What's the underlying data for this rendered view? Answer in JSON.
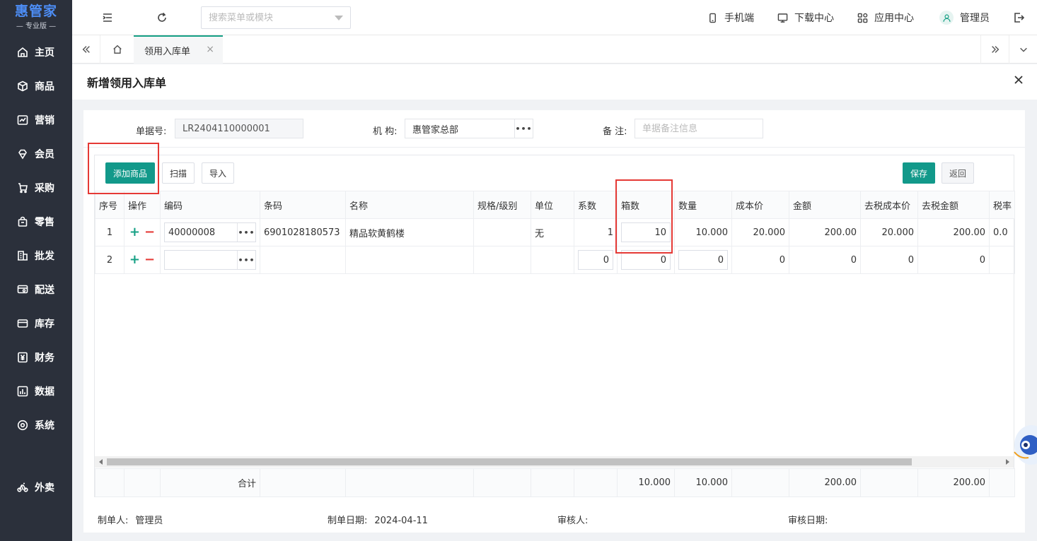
{
  "app": {
    "brand": "惠管家",
    "edition": "— 专业版 —"
  },
  "sidebar": {
    "items": [
      {
        "label": "主页",
        "icon": "home-icon"
      },
      {
        "label": "商品",
        "icon": "cube-icon"
      },
      {
        "label": "营销",
        "icon": "chart-icon"
      },
      {
        "label": "会员",
        "icon": "diamond-icon"
      },
      {
        "label": "采购",
        "icon": "cart-icon"
      },
      {
        "label": "零售",
        "icon": "bag-icon"
      },
      {
        "label": "批发",
        "icon": "building-icon"
      },
      {
        "label": "配送",
        "icon": "truck-icon"
      },
      {
        "label": "库存",
        "icon": "inventory-icon"
      },
      {
        "label": "财务",
        "icon": "yen-icon"
      },
      {
        "label": "数据",
        "icon": "bar-chart-icon"
      },
      {
        "label": "系统",
        "icon": "settings-icon"
      },
      {
        "label": "外卖",
        "icon": "bike-icon"
      }
    ]
  },
  "topbar": {
    "search_placeholder": "搜索菜单或模块",
    "mobile": "手机端",
    "download": "下载中心",
    "apps": "应用中心",
    "user": "管理员"
  },
  "tabs": {
    "active": "领用入库单"
  },
  "panel": {
    "title": "新增领用入库单"
  },
  "form": {
    "doc_no_label": "单据号:",
    "doc_no": "LR2404110000001",
    "org_label": "机 构:",
    "org": "惠管家总部",
    "remark_label": "备 注:",
    "remark_placeholder": "单据备注信息"
  },
  "toolbar": {
    "add": "添加商品",
    "scan": "扫描",
    "import": "导入",
    "save": "保存",
    "back": "返回"
  },
  "grid": {
    "headers": [
      "序号",
      "操作",
      "编码",
      "条码",
      "名称",
      "规格/级别",
      "单位",
      "系数",
      "箱数",
      "数量",
      "成本价",
      "金额",
      "去税成本价",
      "去税金额",
      "税率"
    ],
    "rows": [
      {
        "no": "1",
        "code": "40000008",
        "barcode": "6901028180573",
        "name": "精品软黄鹤楼",
        "spec": "",
        "unit": "无",
        "factor": "1",
        "boxes": "10",
        "qty": "10.000",
        "cost": "20.000",
        "amount": "200.00",
        "net_cost": "20.000",
        "net_amount": "200.00",
        "tax": "0.0"
      },
      {
        "no": "2",
        "code": "",
        "barcode": "",
        "name": "",
        "spec": "",
        "unit": "",
        "factor": "0",
        "boxes": "0",
        "qty": "0",
        "cost": "0",
        "amount": "0",
        "net_cost": "0",
        "net_amount": "0",
        "tax": ""
      }
    ],
    "footer": {
      "label": "合计",
      "boxes": "10.000",
      "qty": "10.000",
      "amount": "200.00",
      "net_amount": "200.00"
    }
  },
  "meta": {
    "maker_label": "制单人:",
    "maker": "管理员",
    "date_label": "制单日期:",
    "date": "2024-04-11",
    "auditor_label": "审核人:",
    "auditor": "",
    "audit_date_label": "审核日期:",
    "audit_date": ""
  },
  "colors": {
    "accent": "#12998a",
    "sidebar": "#2b303b",
    "highlight": "#e53935",
    "brand": "#4d8df5"
  }
}
